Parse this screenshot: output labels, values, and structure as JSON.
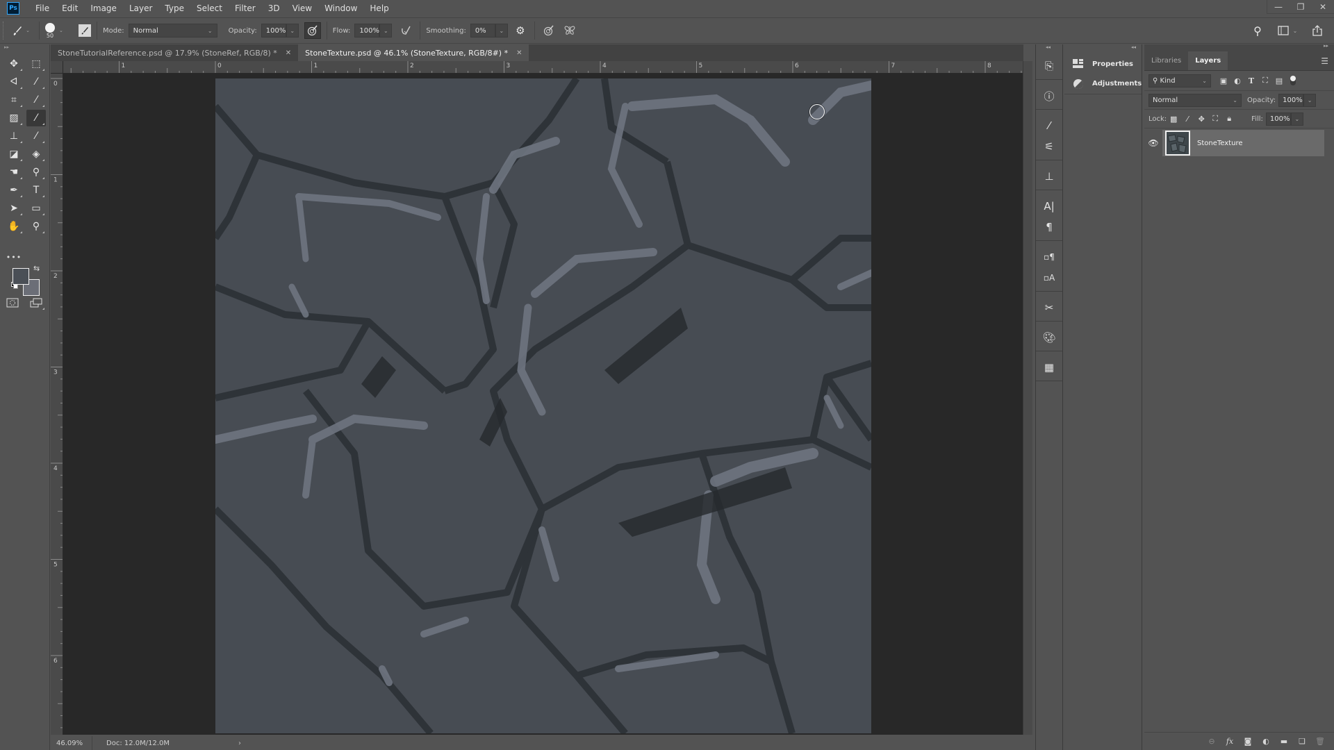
{
  "app": {
    "logo": "Ps",
    "menu": [
      "File",
      "Edit",
      "Image",
      "Layer",
      "Type",
      "Select",
      "Filter",
      "3D",
      "View",
      "Window",
      "Help"
    ],
    "window_controls": {
      "minimize": "minimize-icon",
      "restore": "restore-icon",
      "close": "close-icon"
    }
  },
  "options_bar": {
    "tool_preset_icon": "brush-icon",
    "brush_size": "50",
    "mode_label": "Mode:",
    "mode_value": "Normal",
    "opacity_label": "Opacity:",
    "opacity_value": "100%",
    "flow_label": "Flow:",
    "flow_value": "100%",
    "smoothing_label": "Smoothing:",
    "smoothing_value": "0%",
    "right_icons": [
      "search-icon",
      "workspace-icon",
      "share-icon"
    ]
  },
  "toolbar": {
    "tools": [
      {
        "name": "move-tool",
        "icon": "✥"
      },
      {
        "name": "marquee-tool",
        "icon": "⬚"
      },
      {
        "name": "lasso-tool",
        "icon": "ᐊ"
      },
      {
        "name": "magic-wand-tool",
        "icon": "⁄"
      },
      {
        "name": "crop-tool",
        "icon": "⌗"
      },
      {
        "name": "eyedropper-tool",
        "icon": "⁄"
      },
      {
        "name": "healing-brush-tool",
        "icon": "▨"
      },
      {
        "name": "brush-tool",
        "icon": "⁄",
        "active": true
      },
      {
        "name": "clone-stamp-tool",
        "icon": "⊥"
      },
      {
        "name": "history-brush-tool",
        "icon": "⁄"
      },
      {
        "name": "eraser-tool",
        "icon": "◪"
      },
      {
        "name": "paint-bucket-tool",
        "icon": "◈"
      },
      {
        "name": "smudge-tool",
        "icon": "☚"
      },
      {
        "name": "dodge-tool",
        "icon": "⚲"
      },
      {
        "name": "pen-tool",
        "icon": "✒"
      },
      {
        "name": "type-tool",
        "icon": "T"
      },
      {
        "name": "path-selection-tool",
        "icon": "➤"
      },
      {
        "name": "rectangle-tool",
        "icon": "▭"
      },
      {
        "name": "hand-tool",
        "icon": "✋"
      },
      {
        "name": "zoom-tool",
        "icon": "⚲"
      }
    ],
    "more": "•••",
    "foreground_color": "#4a4f56",
    "background_color": "#6b6e77"
  },
  "tabs": [
    {
      "label": "StoneTutorialReference.psd @ 17.9% (StoneRef, RGB/8) *",
      "active": false
    },
    {
      "label": "StoneTexture.psd @ 46.1% (StoneTexture, RGB/8#) *",
      "active": true
    }
  ],
  "rulers": {
    "horizontal": [
      "1",
      "0",
      "1",
      "2",
      "3",
      "4",
      "5",
      "6",
      "7",
      "8"
    ],
    "vertical": [
      "0",
      "1",
      "2",
      "3",
      "4",
      "5",
      "6"
    ]
  },
  "status": {
    "zoom": "46.09%",
    "doc": "Doc: 12.0M/12.0M",
    "arrow": "›"
  },
  "dock": {
    "icons": [
      "history-icon",
      "info-icon",
      "brush-settings-icon",
      "brush-presets-icon",
      "clone-source-icon",
      "character-icon",
      "paragraph-icon",
      "paragraph-styles-icon",
      "character-styles-icon",
      "tool-presets-icon",
      "swatches-icon",
      "table-icon"
    ]
  },
  "properties_panel": {
    "items": [
      {
        "label": "Properties",
        "icon": "properties-icon"
      },
      {
        "label": "Adjustments",
        "icon": "adjustments-icon"
      }
    ]
  },
  "layers_panel": {
    "tabs": [
      {
        "label": "Libraries",
        "active": false
      },
      {
        "label": "Layers",
        "active": true
      }
    ],
    "filter_kind": "Kind",
    "blend_mode": "Normal",
    "opacity_label": "Opacity:",
    "opacity_value": "100%",
    "lock_label": "Lock:",
    "fill_label": "Fill:",
    "fill_value": "100%",
    "layers": [
      {
        "name": "StoneTexture",
        "visible": true,
        "selected": true
      }
    ]
  }
}
